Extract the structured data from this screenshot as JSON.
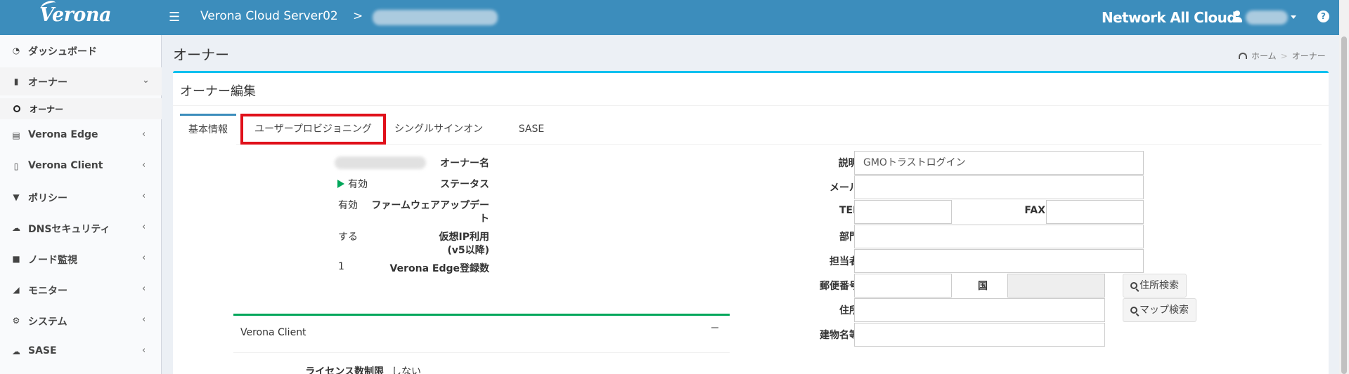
{
  "topbar": {
    "logo": "Verona",
    "server_title": "Verona Cloud Server02",
    "separator": ">",
    "network_title": "Network All Cloud",
    "help": "?"
  },
  "sidebar": {
    "items": [
      {
        "label": "ダッシュボード",
        "icon": "dashboard-icon"
      },
      {
        "label": "オーナー",
        "icon": "building-icon",
        "expanded": true
      },
      {
        "label": "Verona Edge",
        "icon": "hdd-icon"
      },
      {
        "label": "Verona Client",
        "icon": "mobile-icon"
      },
      {
        "label": "ポリシー",
        "icon": "filter-icon"
      },
      {
        "label": "DNSセキュリティ",
        "icon": "cloud-icon"
      },
      {
        "label": "ノード監視",
        "icon": "video-camera-icon"
      },
      {
        "label": "モニター",
        "icon": "area-chart-icon"
      },
      {
        "label": "システム",
        "icon": "gear-icon"
      },
      {
        "label": "SASE",
        "icon": "cloud-icon"
      }
    ],
    "sub_item": "オーナー"
  },
  "header": {
    "title": "オーナー",
    "breadcrumb": {
      "home": "ホーム",
      "current": "オーナー"
    }
  },
  "box": {
    "title": "オーナー編集",
    "tabs": [
      "基本情報",
      "ユーザープロビジョニング",
      "シングルサインオン",
      "SASE"
    ],
    "active_tab": 0,
    "highlighted_tab": 1
  },
  "left_fields": {
    "owner_name_label": "オーナー名",
    "status_label": "ステータス",
    "status_value": "有効",
    "firmware_label_1": "ファームウェアアップデー",
    "firmware_label_2": "ト",
    "firmware_value": "有効",
    "vip_label_1": "仮想IP利用",
    "vip_label_2": "(v5以降)",
    "vip_value": "する",
    "edge_count_label": "Verona Edge登録数",
    "edge_count_value": "1"
  },
  "client_box": {
    "title": "Verona Client",
    "license_label": "ライセンス数制限",
    "license_value": "しない"
  },
  "right_fields": {
    "description_label": "説明",
    "description_value": "GMOトラストログイン",
    "mail_label": "メール",
    "tel_label": "TEL",
    "fax_label": "FAX",
    "dept_label": "部門",
    "person_label": "担当者",
    "zip_label": "郵便番号",
    "country_label": "国",
    "address_search_btn": "住所検索",
    "address_label": "住所",
    "map_search_btn": "マップ検索",
    "building_label": "建物名等"
  },
  "colors": {
    "topbar": "#3c8dbc",
    "box_border": "#00c0ef",
    "client_border": "#00a65a",
    "highlight": "#e0101a",
    "status": "#00a65a"
  }
}
